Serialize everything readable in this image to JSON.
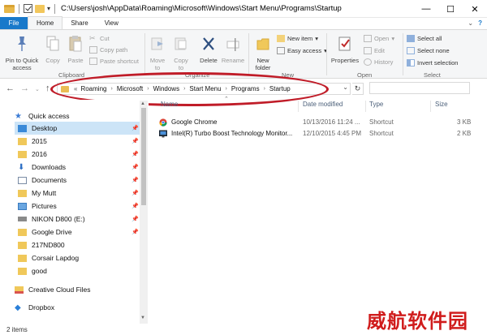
{
  "window": {
    "title": "C:\\Users\\josh\\AppData\\Roaming\\Microsoft\\Windows\\Start Menu\\Programs\\Startup",
    "minimize_glyph": "—",
    "maximize_glyph": "☐",
    "close_glyph": "✕"
  },
  "ribbon_tabs": {
    "file": "File",
    "home": "Home",
    "share": "Share",
    "view": "View"
  },
  "ribbon": {
    "clipboard": {
      "pin": "Pin to Quick\naccess",
      "copy": "Copy",
      "paste": "Paste",
      "cut": "Cut",
      "copy_path": "Copy path",
      "paste_shortcut": "Paste shortcut",
      "label": "Clipboard"
    },
    "organize": {
      "move_to": "Move\nto",
      "copy_to": "Copy\nto",
      "delete": "Delete",
      "rename": "Rename",
      "label": "Organize"
    },
    "new": {
      "new_folder": "New\nfolder",
      "new_item": "New item",
      "easy_access": "Easy access",
      "label": "New"
    },
    "open": {
      "properties": "Properties",
      "open": "Open",
      "edit": "Edit",
      "history": "History",
      "label": "Open"
    },
    "select": {
      "select_all": "Select all",
      "select_none": "Select none",
      "invert": "Invert selection",
      "label": "Select"
    }
  },
  "address": {
    "overflow": "«",
    "segments": [
      "Roaming",
      "Microsoft",
      "Windows",
      "Start Menu",
      "Programs",
      "Startup"
    ]
  },
  "nav_pane": {
    "items": [
      {
        "label": "Quick access",
        "icon": "star-icon",
        "pinned": false
      },
      {
        "label": "Desktop",
        "icon": "desktop-icon",
        "pinned": true
      },
      {
        "label": "2015",
        "icon": "folder-icon",
        "pinned": true
      },
      {
        "label": "2016",
        "icon": "folder-icon",
        "pinned": true
      },
      {
        "label": "Downloads",
        "icon": "download-icon",
        "pinned": true
      },
      {
        "label": "Documents",
        "icon": "documents-icon",
        "pinned": true
      },
      {
        "label": "My Mutt",
        "icon": "folder-icon",
        "pinned": true
      },
      {
        "label": "Pictures",
        "icon": "pictures-icon",
        "pinned": true
      },
      {
        "label": "NIKON D800 (E:)",
        "icon": "drive-icon",
        "pinned": true
      },
      {
        "label": "Google Drive",
        "icon": "folder-icon",
        "pinned": true
      },
      {
        "label": "217ND800",
        "icon": "folder-icon",
        "pinned": false
      },
      {
        "label": "Corsair Lapdog",
        "icon": "folder-icon",
        "pinned": false
      },
      {
        "label": "good",
        "icon": "folder-icon",
        "pinned": false
      },
      {
        "label": "Creative Cloud Files",
        "icon": "creative-cloud-icon",
        "pinned": false
      },
      {
        "label": "Dropbox",
        "icon": "dropbox-icon",
        "pinned": false
      }
    ]
  },
  "columns": {
    "name": "Name",
    "date": "Date modified",
    "type": "Type",
    "size": "Size"
  },
  "files": [
    {
      "name": "Google Chrome",
      "date": "10/13/2016 11:24 ...",
      "type": "Shortcut",
      "size": "3 KB",
      "icon": "chrome-icon"
    },
    {
      "name": "Intel(R) Turbo Boost Technology Monitor...",
      "date": "12/10/2015 4:45 PM",
      "type": "Shortcut",
      "size": "2 KB",
      "icon": "intel-monitor-icon"
    }
  ],
  "status": {
    "count": "2 items"
  },
  "watermark": "威航软件园",
  "colors": {
    "file_tab": "#1979ca",
    "highlight_ellipse": "#c01c28",
    "watermark": "#d01c1c"
  }
}
